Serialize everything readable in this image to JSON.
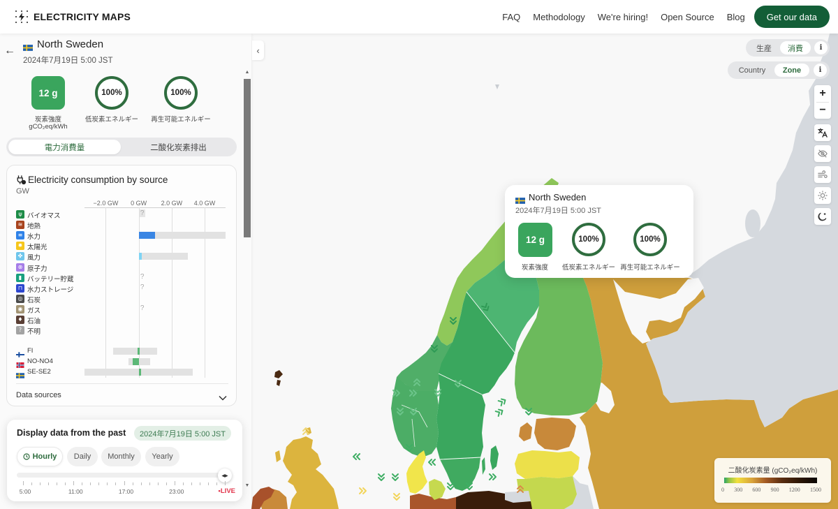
{
  "header": {
    "brand": "ELECTRICITY MAPS",
    "nav": [
      "FAQ",
      "Methodology",
      "We're hiring!",
      "Open Source",
      "Blog"
    ],
    "cta": "Get our data"
  },
  "zone": {
    "flag": "se",
    "name": "North Sweden",
    "datetime": "2024年7月19日 5:00 JST",
    "carbon_intensity": "12 g",
    "carbon_intensity_label": "炭素強度",
    "carbon_intensity_unit": "gCO₂eq/kWh",
    "low_carbon": "100%",
    "low_carbon_label": "低炭素エネルギー",
    "renewable": "100%",
    "renewable_label": "再生可能エネルギー",
    "carbon_color": "#3aa55d"
  },
  "mode_tabs": [
    {
      "label": "電力消費量",
      "active": true
    },
    {
      "label": "二酸化炭素排出",
      "active": false
    }
  ],
  "breakdown": {
    "title": "Electricity consumption by source",
    "unit": "GW",
    "unknown_marker": "?",
    "axis": {
      "domain_gw": [
        -3.29,
        5.27
      ],
      "ticks": [
        {
          "value": -2,
          "label": "−2.0 GW"
        },
        {
          "value": 0,
          "label": "0 GW"
        },
        {
          "value": 2,
          "label": "2.0 GW"
        },
        {
          "value": 4,
          "label": "4.0 GW"
        }
      ]
    },
    "sources": [
      {
        "label": "バイオマス",
        "icon": "biomass",
        "color": "#1d8c47",
        "value_gw": null,
        "capacity_gw": null,
        "unknown": true,
        "unknown_highlight": true
      },
      {
        "label": "地熱",
        "icon": "geothermal",
        "color": "#a8441e",
        "value_gw": 0,
        "capacity_gw": 0,
        "unknown": false
      },
      {
        "label": "水力",
        "icon": "hydro",
        "color": "#2f82e8",
        "value_gw": 0.98,
        "capacity_gw": 5.27,
        "unknown": false,
        "bar_color": "#3a86e4"
      },
      {
        "label": "太陽光",
        "icon": "solar",
        "color": "#f6c61b",
        "value_gw": 0,
        "capacity_gw": 0,
        "unknown": false
      },
      {
        "label": "風力",
        "icon": "wind",
        "color": "#6fc6ec",
        "value_gw": 0.18,
        "capacity_gw": 2.97,
        "unknown": false,
        "bar_color": "#7fd4f4"
      },
      {
        "label": "原子力",
        "icon": "nuclear",
        "color": "#a67ee8",
        "value_gw": 0,
        "capacity_gw": 0,
        "unknown": false
      },
      {
        "label": "バッテリー貯蔵",
        "icon": "battery",
        "color": "#18a07e",
        "value_gw": null,
        "capacity_gw": null,
        "unknown": true
      },
      {
        "label": "水力ストレージ",
        "icon": "hydro-storage",
        "color": "#2d47cf",
        "value_gw": null,
        "capacity_gw": null,
        "unknown": true
      },
      {
        "label": "石炭",
        "icon": "coal",
        "color": "#4a4a4a",
        "value_gw": 0,
        "capacity_gw": 0,
        "unknown": false
      },
      {
        "label": "ガス",
        "icon": "gas",
        "color": "#a39474",
        "value_gw": null,
        "capacity_gw": null,
        "unknown": true
      },
      {
        "label": "石油",
        "icon": "oil",
        "color": "#5a3f35",
        "value_gw": 0,
        "capacity_gw": 0,
        "unknown": false
      },
      {
        "label": "不明",
        "icon": "unknown",
        "color": "#a3a3a3",
        "value_gw": 0,
        "capacity_gw": 0,
        "unknown": false
      }
    ],
    "exchanges": [
      {
        "label": "FI",
        "flag": "fi",
        "range_gw": [
          -1.55,
          1.1
        ],
        "value_gw": -0.08
      },
      {
        "label": "NO-NO4",
        "flag": "no",
        "range_gw": [
          -0.61,
          0.7
        ],
        "value_gw": -0.36
      },
      {
        "label": "SE-SE2",
        "flag": "se",
        "range_gw": [
          -3.3,
          3.3
        ],
        "value_gw": 0.13
      }
    ],
    "exchange_color": "#5cb877",
    "data_sources_label": "Data sources"
  },
  "time_controller": {
    "title": "Display data from the past",
    "selected_datetime": "2024年7月19日 5:00 JST",
    "granularities": [
      {
        "label": "Hourly",
        "active": true
      },
      {
        "label": "Daily",
        "active": false
      },
      {
        "label": "Monthly",
        "active": false
      },
      {
        "label": "Yearly",
        "active": false
      }
    ],
    "slider_position": 1.0,
    "tick_labels": [
      "5:00",
      "11:00",
      "17:00",
      "23:00"
    ],
    "live_label": "LIVE"
  },
  "map": {
    "data_type_toggle": {
      "options": [
        "生産",
        "消費"
      ],
      "active": 1,
      "info": "i"
    },
    "zone_mode_toggle": {
      "options": [
        "Country",
        "Zone"
      ],
      "active": 1,
      "info": "i"
    },
    "controls": [
      "zoom-in",
      "zoom-out",
      "language",
      "hide-overlay",
      "wind-layer",
      "solar-layer",
      "dark-mode"
    ],
    "zoom_in": "+",
    "zoom_out": "−",
    "tooltip": {
      "flag": "se",
      "name": "North Sweden",
      "datetime": "2024年7月19日 5:00 JST",
      "carbon_intensity": "12 g",
      "carbon_intensity_label": "炭素強度",
      "low_carbon": "100%",
      "low_carbon_label": "低炭素エネルギー",
      "renewable": "100%",
      "renewable_label": "再生可能エネルギー"
    },
    "legend": {
      "title": "二酸化炭素量 (gCO₂eq/kWh)",
      "ticks": [
        "0",
        "300",
        "600",
        "900",
        "1200",
        "1500"
      ]
    },
    "zones": {
      "se1": {
        "color": "#4db572"
      },
      "se2": {
        "color": "#3aa75e"
      },
      "se3": {
        "color": "#3aa75e"
      },
      "se4": {
        "color": "#40aa60"
      },
      "no4": {
        "color": "#8fc85a"
      },
      "no3": {
        "color": "#50ae68"
      },
      "no_south": {
        "color": "#4cad66"
      },
      "fi": {
        "color": "#6cba5c"
      },
      "ru": {
        "color": "#cf9f3c"
      },
      "nodata": {
        "color": "#d5d9de"
      },
      "ee": {
        "color": "#c8893a"
      },
      "lv": {
        "color": "#ece04a"
      },
      "lt": {
        "color": "#c4d84e"
      },
      "pl": {
        "color": "#3a1d0a"
      },
      "de": {
        "color": "#a9552b"
      },
      "dk1": {
        "color": "#f1e54b"
      },
      "dk2": {
        "color": "#c6d94f"
      },
      "gb": {
        "color": "#dcb43e"
      },
      "ie": {
        "color": "#c98a3a"
      },
      "gb_ni": {
        "color": "#a8512b"
      },
      "fo": {
        "color": "#4a2a12"
      }
    }
  }
}
